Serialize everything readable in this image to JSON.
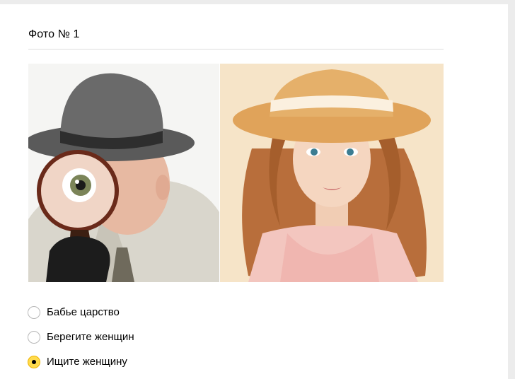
{
  "question": {
    "title": "Фото № 1"
  },
  "photos": [
    {
      "icon": "detective-with-magnifying-glass-photo"
    },
    {
      "icon": "woman-in-sun-hat-photo"
    }
  ],
  "options": [
    {
      "label": "Бабье царство",
      "selected": false
    },
    {
      "label": "Берегите женщин",
      "selected": false
    },
    {
      "label": "Ищите женщину",
      "selected": true
    }
  ],
  "colors": {
    "radio_selected": "#ffdb4d",
    "radio_border": "#b8b8b8",
    "divider": "#dcdcdc"
  }
}
